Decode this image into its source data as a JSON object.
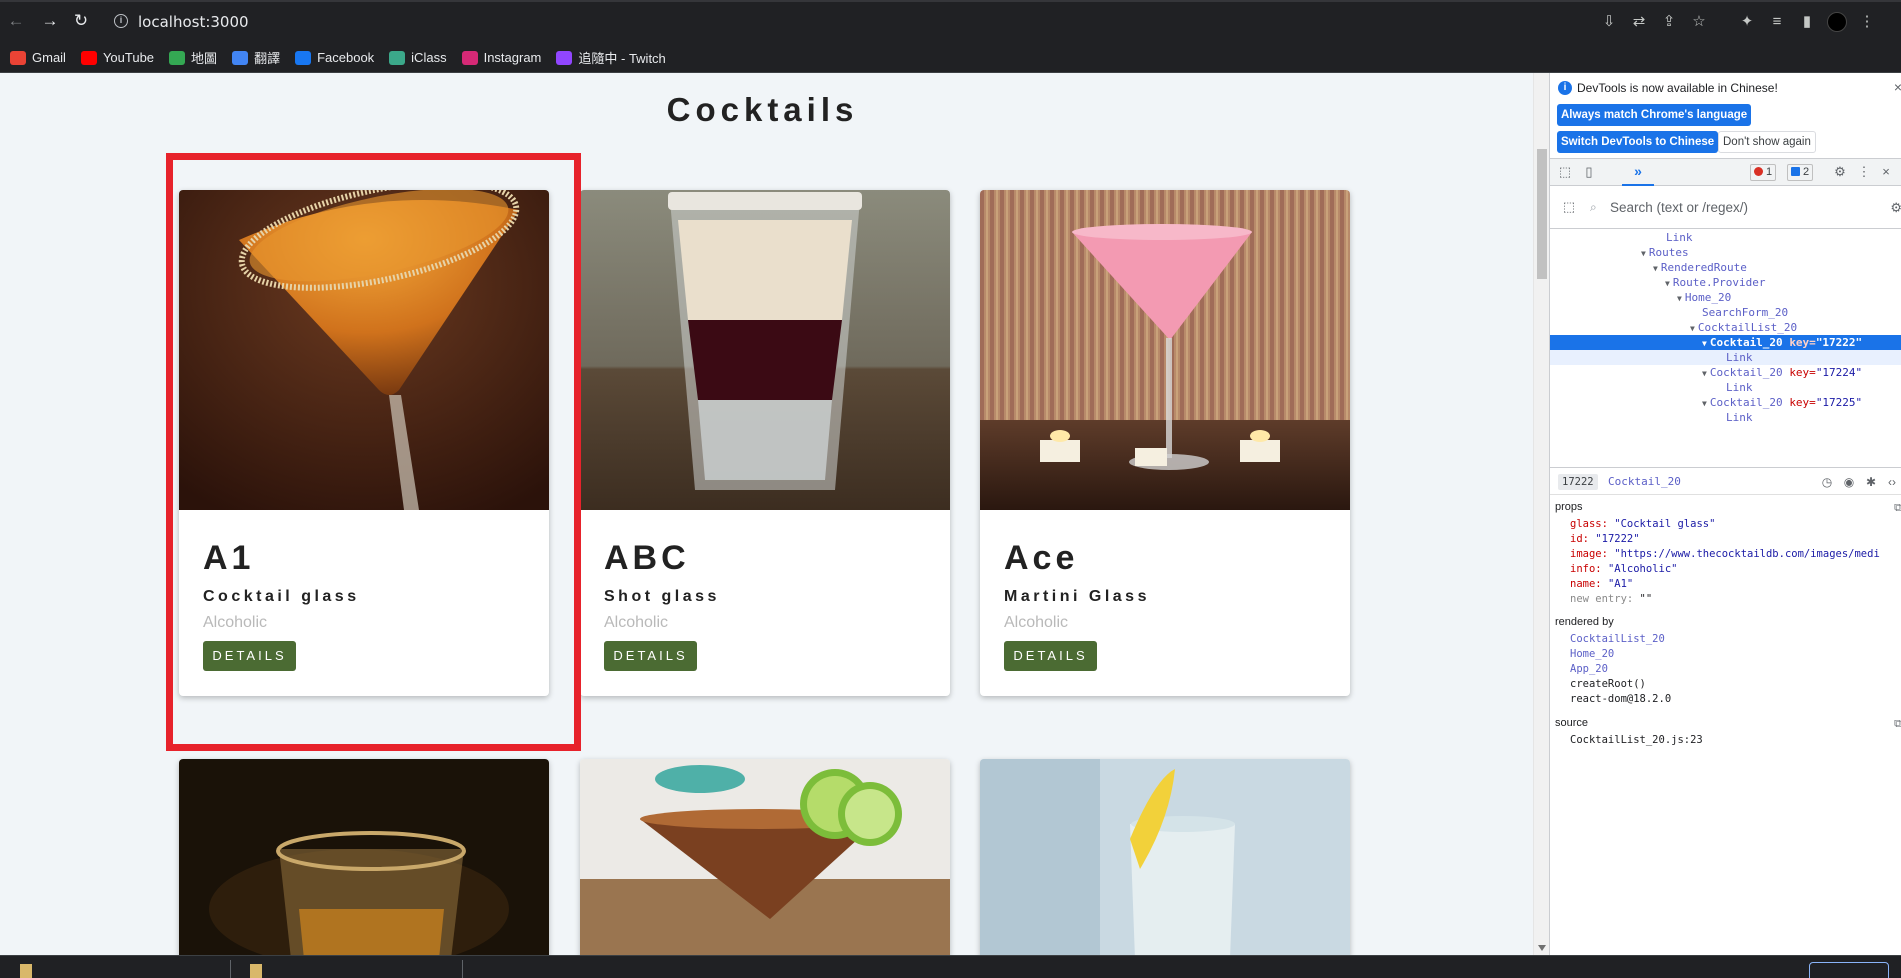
{
  "browser": {
    "url": "localhost:3000",
    "bookmarks": [
      {
        "label": "Gmail",
        "icon": "gmail-icon",
        "color": "#ea4335"
      },
      {
        "label": "YouTube",
        "icon": "youtube-icon",
        "color": "#ff0000"
      },
      {
        "label": "地圖",
        "icon": "maps-icon",
        "color": "#34a853"
      },
      {
        "label": "翻譯",
        "icon": "translate-icon",
        "color": "#4285f4"
      },
      {
        "label": "Facebook",
        "icon": "facebook-icon",
        "color": "#1877f2"
      },
      {
        "label": "iClass",
        "icon": "iclass-icon",
        "color": "#3ba88a"
      },
      {
        "label": "Instagram",
        "icon": "instagram-icon",
        "color": "#d62976"
      },
      {
        "label": "追隨中 - Twitch",
        "icon": "twitch-icon",
        "color": "#9146ff"
      }
    ]
  },
  "page": {
    "title": "Cocktails",
    "details_label": "DETAILS",
    "accent": "#4b6b33",
    "cards": [
      {
        "name": "A1",
        "glass": "Cocktail glass",
        "info": "Alcoholic"
      },
      {
        "name": "ABC",
        "glass": "Shot glass",
        "info": "Alcoholic"
      },
      {
        "name": "Ace",
        "glass": "Martini Glass",
        "info": "Alcoholic"
      }
    ]
  },
  "devtools": {
    "notice": "DevTools is now available in Chinese!",
    "btn_match": "Always match Chrome's language",
    "btn_switch": "Switch DevTools to Chinese",
    "btn_dont": "Don't show again",
    "errors": "1",
    "messages": "2",
    "search_placeholder": "Search (text or /regex/)",
    "tree": {
      "link1": "Link",
      "routes": "Routes",
      "rendered_route": "RenderedRoute",
      "route_provider": "Route.Provider",
      "home": "Home_20",
      "search_form": "SearchForm_20",
      "cocktail_list": "CocktailList_20",
      "cocktail_sel": "Cocktail_20",
      "key_attr": "key=",
      "key_sel": "\"17222\"",
      "link2": "Link",
      "cocktail_mid": "Cocktail_20",
      "key_mid": "\"17224\"",
      "link3": "Link",
      "cocktail_3": "Cocktail_20",
      "key_3": "\"17225\"",
      "link4": "Link"
    },
    "selected_key": "17222",
    "selected_name": "Cocktail_20",
    "props_label": "props",
    "props": [
      {
        "k": "glass:",
        "v": "\"Cocktail glass\""
      },
      {
        "k": "id:",
        "v": "\"17222\""
      },
      {
        "k": "image:",
        "v": "\"https://www.thecocktaildb.com/images/medi"
      },
      {
        "k": "info:",
        "v": "\"Alcoholic\""
      },
      {
        "k": "name:",
        "v": "\"A1\""
      }
    ],
    "new_entry": "new entry:",
    "new_entry_val": "\"\"",
    "rendered_by_label": "rendered by",
    "rendered_by": [
      "CocktailList_20",
      "Home_20",
      "App_20"
    ],
    "rendered_plain": [
      "createRoot()",
      "react-dom@18.2.0"
    ],
    "source_label": "source",
    "source_file": "CocktailList_20.js:23"
  }
}
